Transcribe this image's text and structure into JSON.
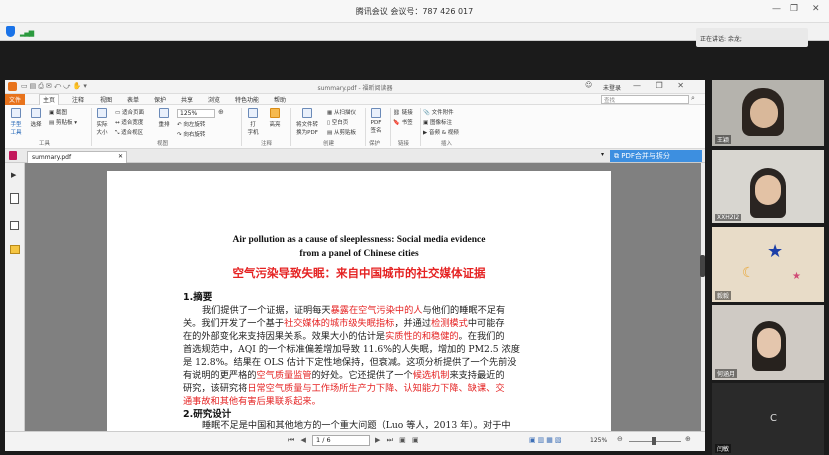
{
  "meeting": {
    "title": "腾讯会议 会议号：787 426 017",
    "speaking": "正在讲话: 余龙;"
  },
  "pdf": {
    "filename": "summary.pdf - 福昕阅读器",
    "tab": "summary.pdf",
    "merge": "PDF合并与拆分",
    "login": "未登录",
    "search_placeholder": "查找",
    "zoom": "125%",
    "page": "1 / 6",
    "status_zoom": "125%"
  },
  "menu": [
    "文件",
    "主页",
    "注释",
    "视图",
    "表单",
    "保护",
    "共享",
    "浏览",
    "特色功能",
    "帮助"
  ],
  "ribbon": {
    "hand": "手型\n工具",
    "select": "选择",
    "snapshot": "截图",
    "clipboard": "剪贴板",
    "actual": "实际\n大小",
    "fitpage": "适合页面",
    "fitwidth": "适合宽度",
    "fitvisible": "适合视区",
    "reflow": "重排",
    "rotate_left": "向左旋转",
    "rotate_right": "向右旋转",
    "typewriter": "打\n字机",
    "highlight": "高亮",
    "convert": "将文件转\n换为PDF",
    "from_scanner": "从扫描仪",
    "blank": "空白页",
    "from_clipboard": "从剪贴板",
    "sign": "PDF\n签名",
    "link": "链接",
    "bookmark": "书签",
    "file_attach": "文件附件",
    "image_annot": "图像标注",
    "audio_video": "音频 & 视频",
    "groups": {
      "tools": "工具",
      "view": "视图",
      "comment": "注释",
      "create": "创建",
      "protect": "保护",
      "links": "链接",
      "insert": "插入"
    }
  },
  "doc": {
    "en_title1": "Air pollution as a cause of sleeplessness: Social media evidence",
    "en_title2": "from a panel of Chinese cities",
    "cn_title": "空气污染导致失眠：来自中国城市的社交媒体证据",
    "h1": "1.摘要",
    "lines": [
      [
        {
          "t": "我们提供了一个证据，证明每天",
          "r": false
        },
        {
          "t": "暴露在空气污染中的人",
          "r": true
        },
        {
          "t": "与他们的睡眠不足有",
          "r": false
        }
      ],
      [
        {
          "t": "关。我们开发了一个基于",
          "r": false
        },
        {
          "t": "社交媒体的城市级失眠指标",
          "r": true
        },
        {
          "t": "，并通过",
          "r": false
        },
        {
          "t": "检测模式",
          "r": true
        },
        {
          "t": "中可能存",
          "r": false
        }
      ],
      [
        {
          "t": "在的外部变化来支持因果关系。效果大小的估计是",
          "r": false
        },
        {
          "t": "实质性的和稳健的",
          "r": true
        },
        {
          "t": "。在我们的",
          "r": false
        }
      ],
      [
        {
          "t": "首选规范中，AQI 的一个标准偏差增加导致 11.6%的人失眠，增加的 PM2.5 浓度",
          "r": false
        }
      ],
      [
        {
          "t": "是 12.8%。结果在 OLS 估计下定性地保持，但衰减。这项分析提供了一个先前没",
          "r": false
        }
      ],
      [
        {
          "t": "有说明的更严格的",
          "r": false
        },
        {
          "t": "空气质量监管",
          "r": true
        },
        {
          "t": "的好处。它还提供了一个",
          "r": false
        },
        {
          "t": "候选机制",
          "r": true
        },
        {
          "t": "来支持最近的",
          "r": false
        }
      ],
      [
        {
          "t": "研究，该研究将",
          "r": false
        },
        {
          "t": "日常空气质量与工作场所生产力下降、认知能力下降、缺课、交",
          "r": true
        }
      ],
      [
        {
          "t": "通事故和其他有害后果联系起来。",
          "r": true
        }
      ]
    ],
    "h2": "2.研究设计",
    "line_last": "睡眠不足是中国和其他地方的一个重大问题（Luo 等人，2013 年）。对于中"
  },
  "participants": [
    {
      "name": "王颖"
    },
    {
      "name": "XXH2I2"
    },
    {
      "name": "毅毅"
    },
    {
      "name": "何涵月"
    },
    {
      "name": "闫敏"
    }
  ]
}
